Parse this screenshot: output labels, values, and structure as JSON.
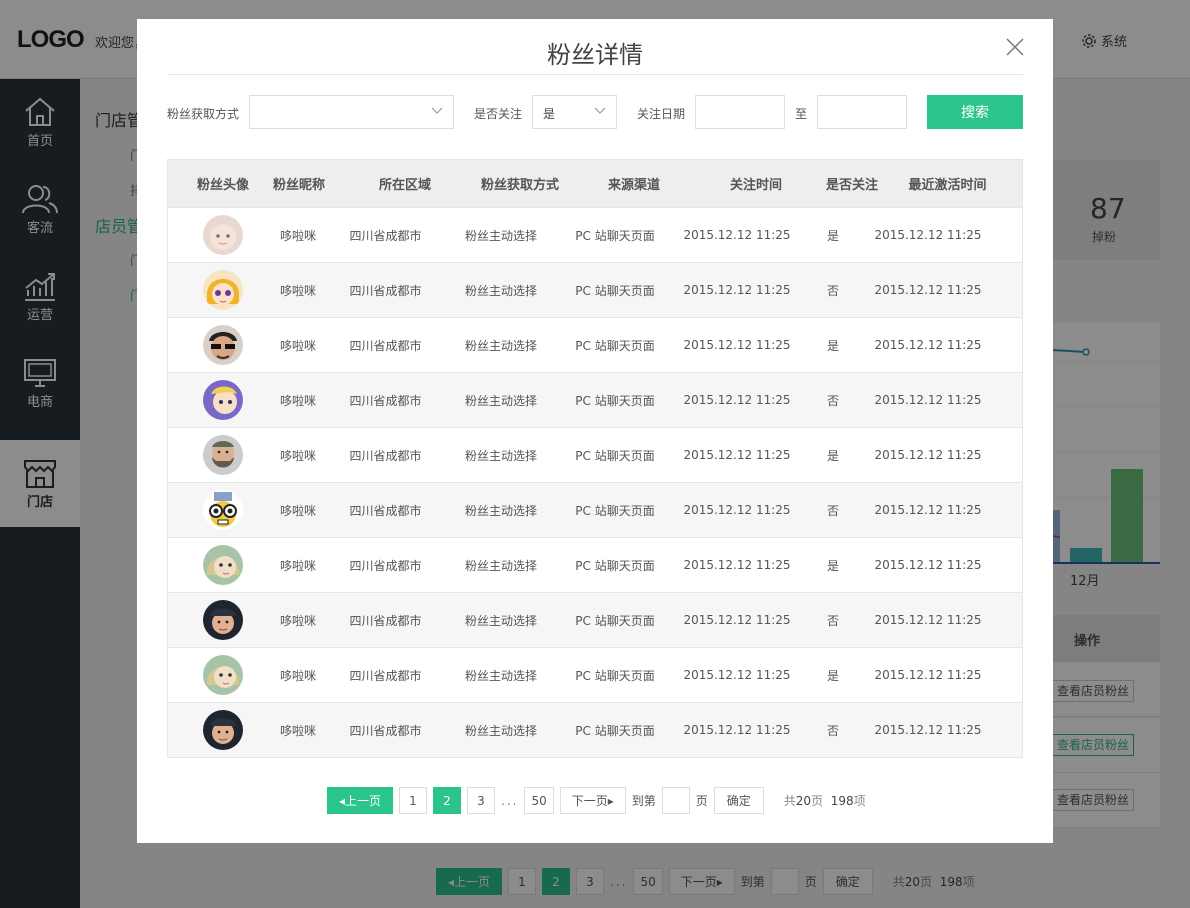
{
  "header": {
    "logo": "LOGO",
    "welcome": "欢迎您，",
    "system": "系统"
  },
  "sidebar": {
    "items": [
      {
        "label": "首页",
        "icon": "home-icon"
      },
      {
        "label": "客流",
        "icon": "users-icon"
      },
      {
        "label": "运营",
        "icon": "chart-icon"
      },
      {
        "label": "电商",
        "icon": "monitor-icon"
      },
      {
        "label": "门店",
        "icon": "store-icon",
        "active": true
      }
    ]
  },
  "subnav": {
    "groups": [
      "门店管",
      "店员管"
    ],
    "subs": [
      "门",
      "排",
      "门",
      "门"
    ]
  },
  "background": {
    "stat": {
      "value": "87",
      "label": "掉粉"
    },
    "chart_month": "12月",
    "op_header": "操作",
    "op_buttons": [
      "查看店员粉丝",
      "查看店员粉丝",
      "查看店员粉丝"
    ]
  },
  "modal": {
    "title": "粉丝详情",
    "filters": {
      "source_label": "粉丝获取方式",
      "source_value": "",
      "follow_label": "是否关注",
      "follow_value": "是",
      "date_label": "关注日期",
      "date_sep": "至",
      "search_btn": "搜索"
    },
    "columns": [
      "粉丝头像",
      "粉丝昵称",
      "所在区域",
      "粉丝获取方式",
      "来源渠道",
      "关注时间",
      "是否关注",
      "最近激活时间"
    ],
    "rows": [
      {
        "nickname": "哆啦咪",
        "region": "四川省成都市",
        "method": "粉丝主动选择",
        "channel": "PC 站聊天页面",
        "follow_time": "2015.12.12 11:25",
        "followed": "是",
        "last_active": "2015.12.12 11:25",
        "avatar": "baby"
      },
      {
        "nickname": "哆啦咪",
        "region": "四川省成都市",
        "method": "粉丝主动选择",
        "channel": "PC 站聊天页面",
        "follow_time": "2015.12.12 11:25",
        "followed": "否",
        "last_active": "2015.12.12 11:25",
        "avatar": "cartoon-girl"
      },
      {
        "nickname": "哆啦咪",
        "region": "四川省成都市",
        "method": "粉丝主动选择",
        "channel": "PC 站聊天页面",
        "follow_time": "2015.12.12 11:25",
        "followed": "是",
        "last_active": "2015.12.12 11:25",
        "avatar": "sunglasses-man"
      },
      {
        "nickname": "哆啦咪",
        "region": "四川省成都市",
        "method": "粉丝主动选择",
        "channel": "PC 站聊天页面",
        "follow_time": "2015.12.12 11:25",
        "followed": "否",
        "last_active": "2015.12.12 11:25",
        "avatar": "purple-cartoon"
      },
      {
        "nickname": "哆啦咪",
        "region": "四川省成都市",
        "method": "粉丝主动选择",
        "channel": "PC 站聊天页面",
        "follow_time": "2015.12.12 11:25",
        "followed": "是",
        "last_active": "2015.12.12 11:25",
        "avatar": "beard-man"
      },
      {
        "nickname": "哆啦咪",
        "region": "四川省成都市",
        "method": "粉丝主动选择",
        "channel": "PC 站聊天页面",
        "follow_time": "2015.12.12 11:25",
        "followed": "否",
        "last_active": "2015.12.12 11:25",
        "avatar": "glasses-cartoon"
      },
      {
        "nickname": "哆啦咪",
        "region": "四川省成都市",
        "method": "粉丝主动选择",
        "channel": "PC 站聊天页面",
        "follow_time": "2015.12.12 11:25",
        "followed": "是",
        "last_active": "2015.12.12 11:25",
        "avatar": "green-girl"
      },
      {
        "nickname": "哆啦咪",
        "region": "四川省成都市",
        "method": "粉丝主动选择",
        "channel": "PC 站聊天页面",
        "follow_time": "2015.12.12 11:25",
        "followed": "否",
        "last_active": "2015.12.12 11:25",
        "avatar": "cap-man"
      },
      {
        "nickname": "哆啦咪",
        "region": "四川省成都市",
        "method": "粉丝主动选择",
        "channel": "PC 站聊天页面",
        "follow_time": "2015.12.12 11:25",
        "followed": "是",
        "last_active": "2015.12.12 11:25",
        "avatar": "green-girl"
      },
      {
        "nickname": "哆啦咪",
        "region": "四川省成都市",
        "method": "粉丝主动选择",
        "channel": "PC 站聊天页面",
        "follow_time": "2015.12.12 11:25",
        "followed": "否",
        "last_active": "2015.12.12 11:25",
        "avatar": "cap-man"
      }
    ],
    "pager": {
      "prev": "上一页",
      "pages": [
        "1",
        "2",
        "3"
      ],
      "current": "2",
      "dots": "...",
      "last": "50",
      "next": "下一页",
      "goto": "到第",
      "page_unit": "页",
      "confirm": "确定",
      "total_prefix": "共",
      "total_pages": "20",
      "total_pages_unit": "页",
      "total_items": "198",
      "total_items_unit": "项"
    }
  },
  "colors": {
    "accent": "#2bc48a",
    "sidebar": "#2b333b"
  }
}
